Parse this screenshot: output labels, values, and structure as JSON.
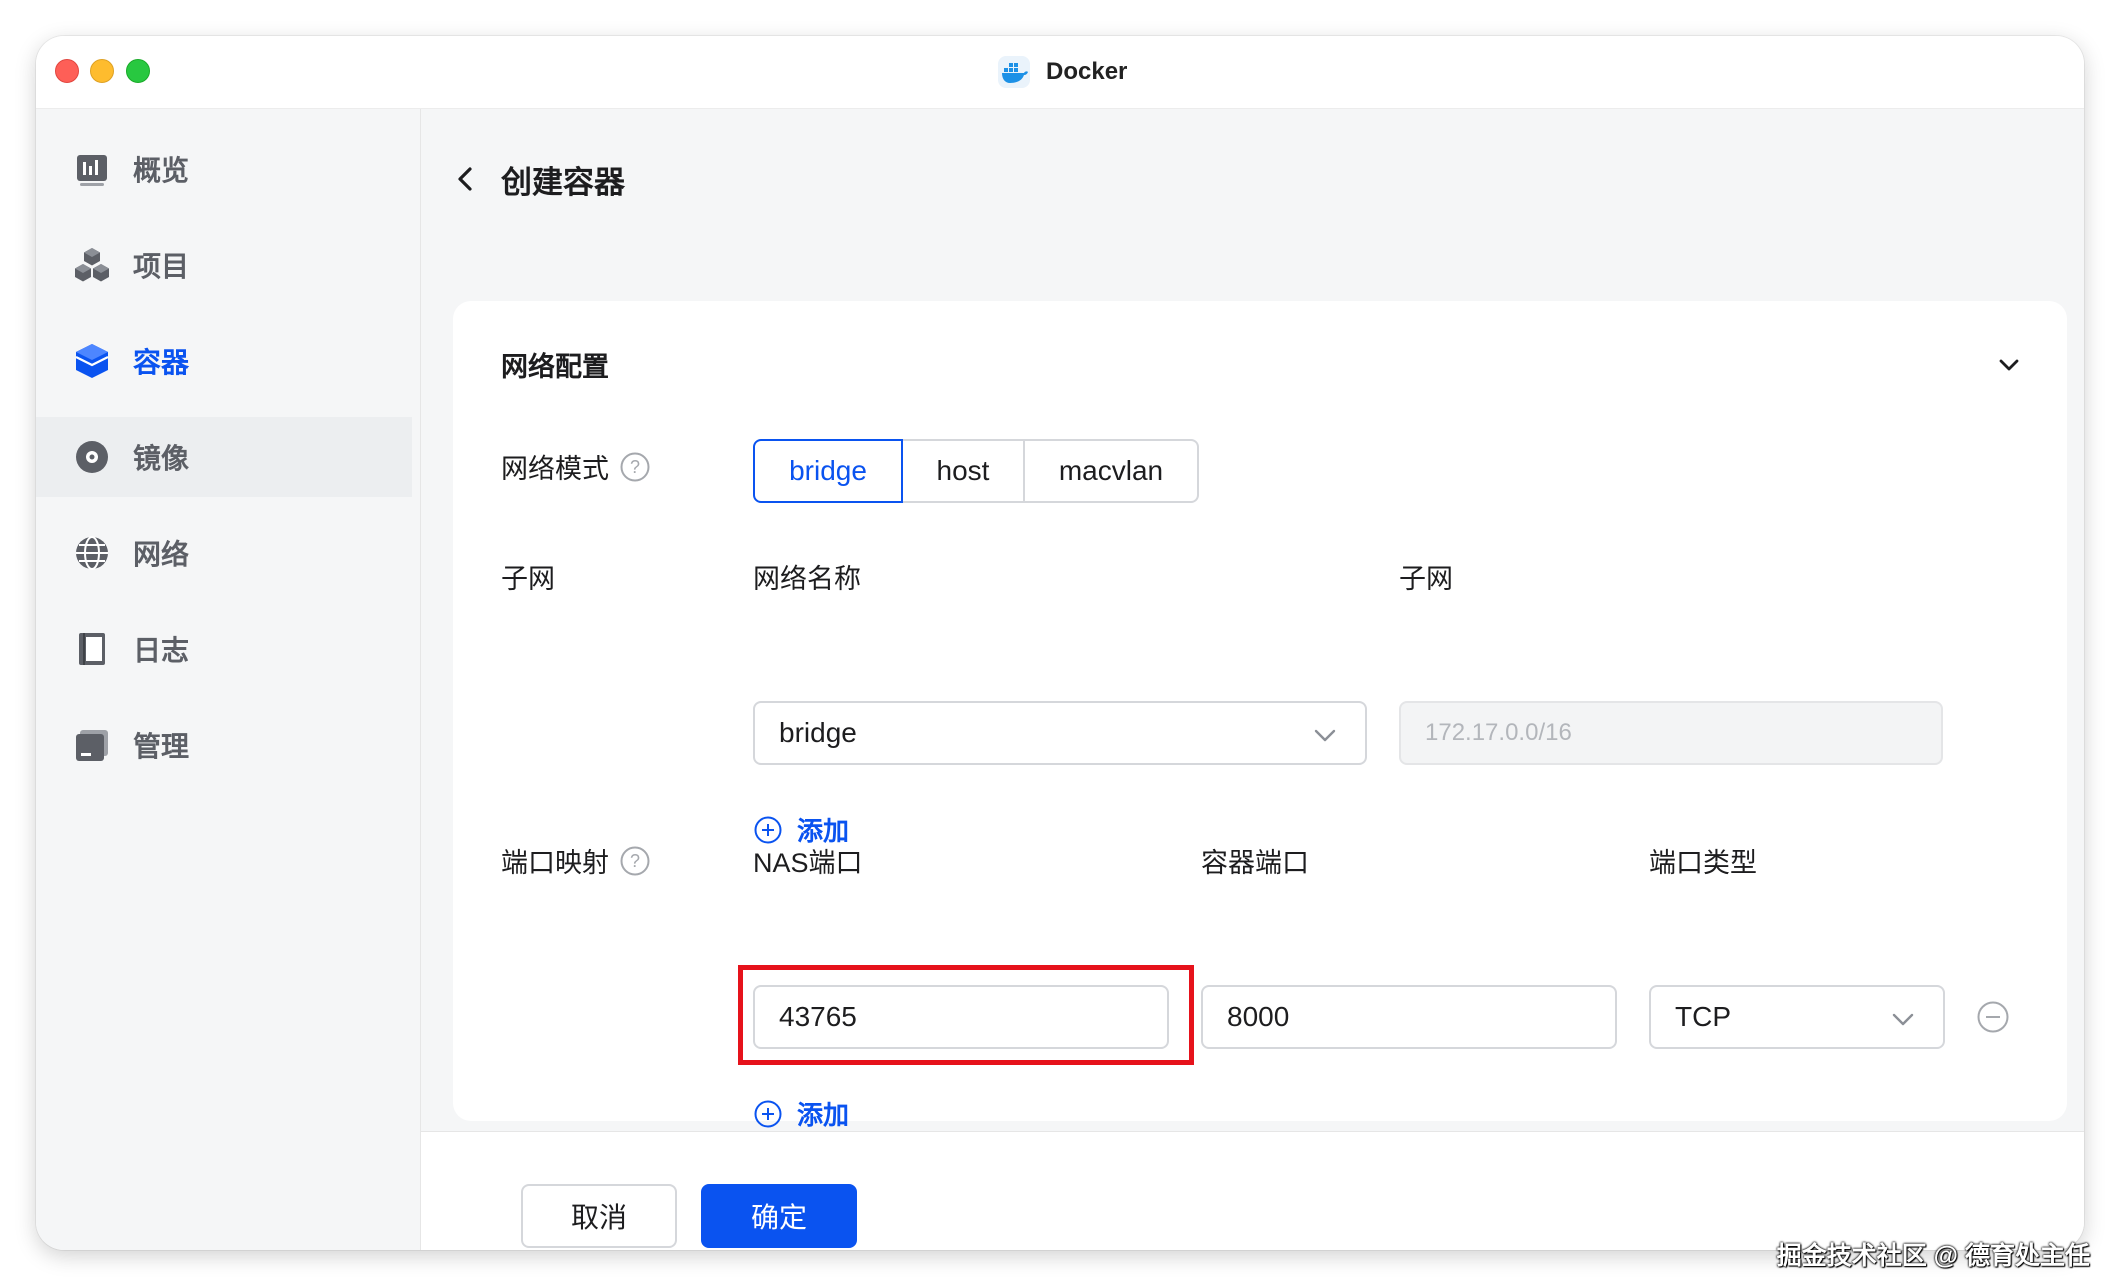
{
  "window": {
    "title": "Docker"
  },
  "sidebar": {
    "items": [
      {
        "label": "概览",
        "icon": "overview-icon"
      },
      {
        "label": "项目",
        "icon": "project-icon"
      },
      {
        "label": "容器",
        "icon": "container-icon",
        "active": true
      },
      {
        "label": "镜像",
        "icon": "image-icon"
      },
      {
        "label": "网络",
        "icon": "network-icon"
      },
      {
        "label": "日志",
        "icon": "log-icon"
      },
      {
        "label": "管理",
        "icon": "manage-icon"
      }
    ]
  },
  "page": {
    "title": "创建容器"
  },
  "section": {
    "title": "网络配置"
  },
  "network_mode": {
    "label": "网络模式",
    "options": [
      "bridge",
      "host",
      "macvlan"
    ],
    "selected": "bridge"
  },
  "subnet": {
    "label": "子网",
    "name_header": "网络名称",
    "subnet_header": "子网",
    "network_name": "bridge",
    "subnet_value": "172.17.0.0/16",
    "add_label": "添加"
  },
  "port_mapping": {
    "label": "端口映射",
    "nas_header": "NAS端口",
    "container_header": "容器端口",
    "type_header": "端口类型",
    "nas_port": "43765",
    "container_port": "8000",
    "port_type": "TCP",
    "add_label": "添加"
  },
  "footer": {
    "cancel_label": "取消",
    "ok_label": "确定"
  },
  "watermark": "掘金技术社区 @ 德育处主任",
  "colors": {
    "accent": "#0a53f0",
    "highlight": "#e6121b"
  }
}
